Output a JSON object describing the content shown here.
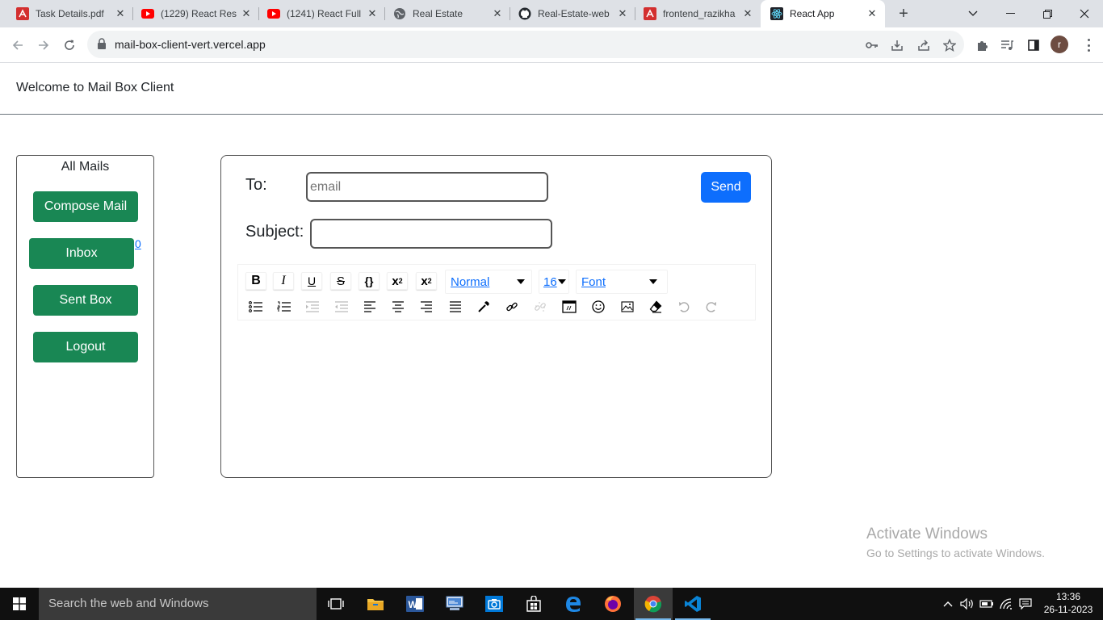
{
  "browser": {
    "tabs": [
      {
        "title": "Task Details.pdf",
        "icon": "pdf-icon"
      },
      {
        "title": "(1229) React Res",
        "icon": "youtube-icon"
      },
      {
        "title": "(1241) React Full",
        "icon": "youtube-icon"
      },
      {
        "title": "Real Estate",
        "icon": "globe-icon"
      },
      {
        "title": "Real-Estate-web",
        "icon": "github-icon"
      },
      {
        "title": "frontend_razikha",
        "icon": "pdf-icon"
      },
      {
        "title": "React App",
        "icon": "react-icon"
      }
    ],
    "url": "mail-box-client-vert.vercel.app",
    "profile_initial": "r"
  },
  "header": {
    "welcome": "Welcome to Mail Box Client"
  },
  "sidebar": {
    "heading": "All Mails",
    "compose_label": "Compose Mail",
    "inbox_label": "Inbox",
    "inbox_count": "0",
    "sent_label": "Sent Box",
    "logout_label": "Logout"
  },
  "composer": {
    "to_label": "To:",
    "to_placeholder": "email",
    "to_value": "",
    "subject_label": "Subject:",
    "subject_value": "",
    "send_label": "Send",
    "block_type": "Normal",
    "font_size": "16",
    "font_family": "Font"
  },
  "watermark": {
    "title": "Activate Windows",
    "subtitle": "Go to Settings to activate Windows."
  },
  "taskbar": {
    "search_placeholder": "Search the web and Windows",
    "time": "13:36",
    "date": "26-11-2023"
  },
  "colors": {
    "green_button": "#198754",
    "send_button": "#0d6efd",
    "link": "#0d6efd"
  }
}
